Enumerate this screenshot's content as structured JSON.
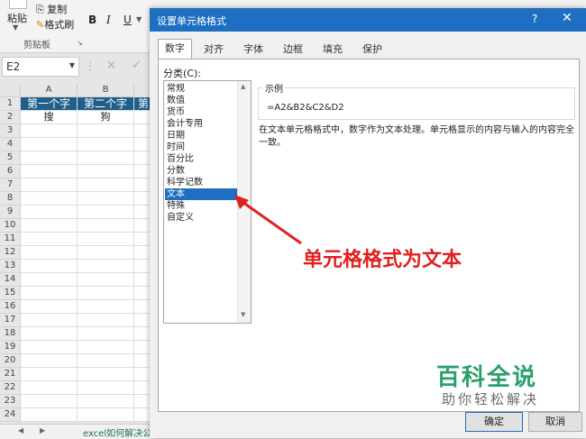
{
  "ribbon": {
    "paste": "粘贴",
    "copy": "复制",
    "format_painter": "格式刷",
    "clipboard_group": "剪贴板",
    "bold": "B",
    "italic": "I",
    "underline": "U"
  },
  "formula_bar": {
    "name_box": "E2",
    "cancel": "×",
    "confirm": "✓"
  },
  "sheet": {
    "columns": [
      "A",
      "B"
    ],
    "rows": [
      "1",
      "2",
      "3",
      "4",
      "5",
      "6",
      "7",
      "8",
      "9",
      "10",
      "11",
      "12",
      "13",
      "14",
      "15",
      "16",
      "17",
      "18",
      "19",
      "20",
      "21",
      "22",
      "23",
      "24"
    ],
    "header_cells": [
      "第一个字",
      "第二个字",
      "第"
    ],
    "row2_cells": [
      "搜",
      "狗",
      ""
    ],
    "tab_label": "excel如何解决公"
  },
  "dialog": {
    "title": "设置单元格格式",
    "help": "?",
    "close": "✕",
    "tabs": [
      "数字",
      "对齐",
      "字体",
      "边框",
      "填充",
      "保护"
    ],
    "active_tab": "数字",
    "category_label": "分类(C):",
    "categories": [
      "常规",
      "数值",
      "货币",
      "会计专用",
      "日期",
      "时间",
      "百分比",
      "分数",
      "科学记数",
      "文本",
      "特殊",
      "自定义"
    ],
    "selected_category": "文本",
    "sample_label": "示例",
    "sample_value": "=A2&B2&C2&D2",
    "description": "在文本单元格格式中，数字作为文本处理。单元格显示的内容与输入的内容完全一致。",
    "ok": "确定",
    "cancel": "取消"
  },
  "annotation": {
    "text": "单元格格式为文本",
    "color": "#e02020"
  },
  "watermark": {
    "line1": "百科全说",
    "line2": "助你轻松解决"
  },
  "colors": {
    "accent": "#1e6fc2",
    "header_fill": "#1f5f8b",
    "annotation": "#e02020",
    "watermark": "#2aa06a"
  }
}
